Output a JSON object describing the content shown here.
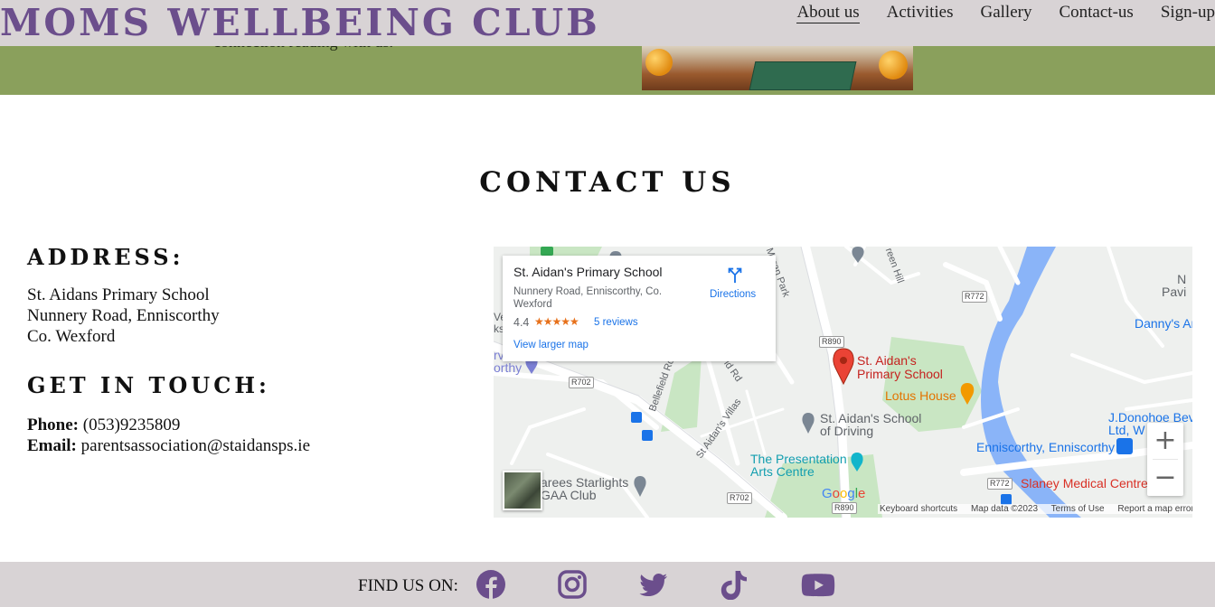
{
  "header": {
    "brand": "MOMS WELLBEING CLUB",
    "nav": [
      "About us",
      "Activities",
      "Gallery",
      "Contact-us",
      "Sign-up"
    ]
  },
  "hero_strip": {
    "text": "connection reading with us."
  },
  "contact": {
    "title": "CONTACT US",
    "address_heading": "ADDRESS:",
    "address_lines": [
      "St. Aidans Primary School",
      "Nunnery Road, Enniscorthy",
      "Co. Wexford"
    ],
    "touch_heading": "GET IN TOUCH:",
    "phone_label": "Phone:",
    "phone_value": "(053)9235809",
    "email_label": "Email:",
    "email_value": "parentsassociation@staidansps.ie"
  },
  "map": {
    "card": {
      "name": "St. Aidan's Primary School",
      "address": "Nunnery Road, Enniscorthy, Co. Wexford",
      "rating": "4.4",
      "stars": "★★★★★",
      "reviews": "5 reviews",
      "view_larger": "View larger map",
      "directions": "Directions"
    },
    "labels": {
      "school": "St. Aidan's\nPrimary School",
      "lotus": "Lotus House",
      "driving": "St. Aidan's School\nof Driving",
      "presentation": "The Presentation\nArts Centre",
      "starlights": "arees Starlights\nGAA Club",
      "enniscorthy": "Enniscorthy, Enniscorthy",
      "slaney": "Slaney Medical Centre",
      "donohoe": "J.Donohoe Bev\nLtd, W        le",
      "dannys": "Danny's Ar",
      "pavi": "N\nPavi",
      "orthy": "orthy",
      "rv": "rv",
      "ve": "Ve\nks",
      "moran_park": "Moran Park",
      "green_hill": "reen Hill",
      "bellefield": "Bellefield Rd",
      "bellefield2": "ld Rd",
      "villas": "St Aidan's Villas"
    },
    "roads": [
      "R772",
      "R890",
      "R702",
      "R702",
      "R772",
      "R890"
    ],
    "zoom_in": "+",
    "zoom_out": "−",
    "google": "Google",
    "attribution": [
      "Keyboard shortcuts",
      "Map data ©2023",
      "Terms of Use",
      "Report a map error"
    ]
  },
  "footer": {
    "find_us": "FIND US ON:",
    "social": [
      "facebook-icon",
      "instagram-icon",
      "twitter-icon",
      "tiktok-icon",
      "youtube-icon"
    ],
    "icon_color": "#6b4e8c"
  },
  "colors": {
    "brand": "#6b4e8c",
    "header_bg": "#d8d3d5",
    "strip_green": "#8aa05c",
    "link_blue": "#1a73e8",
    "pin_red": "#ea4335"
  }
}
